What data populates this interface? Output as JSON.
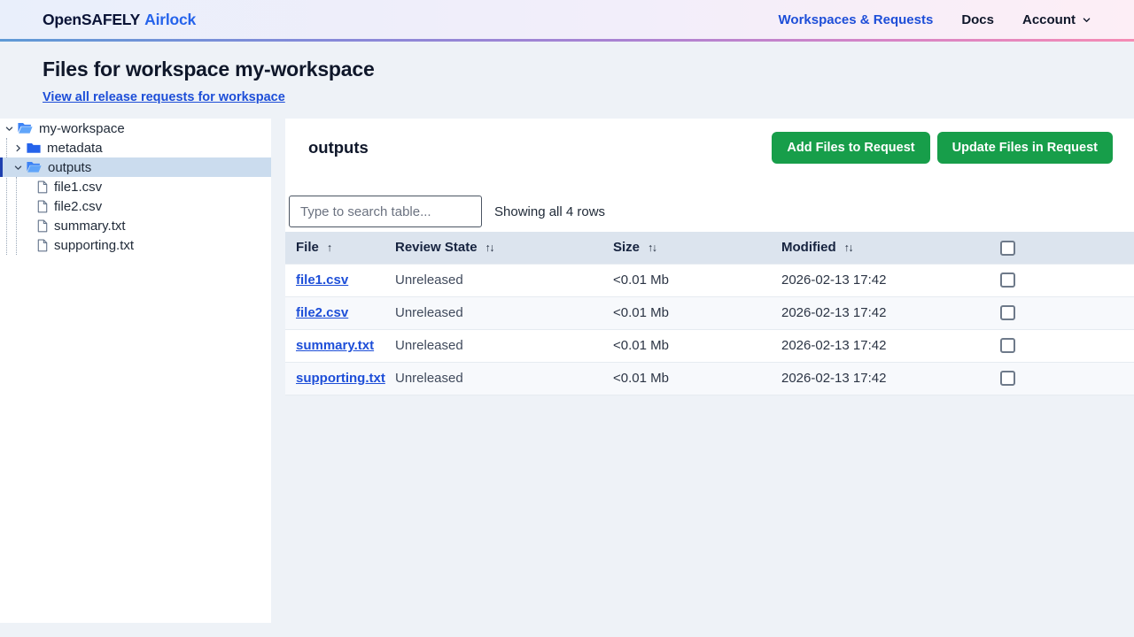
{
  "brand": {
    "name": "OpenSAFELY",
    "product": "Airlock"
  },
  "nav": {
    "workspaces_label": "Workspaces & Requests",
    "docs_label": "Docs",
    "account_label": "Account"
  },
  "page_header": {
    "title": "Files for workspace my-workspace",
    "link_label": "View all release requests for workspace"
  },
  "tree": {
    "items": [
      {
        "label": "my-workspace",
        "icon": "folder-open",
        "chevron": "down",
        "depth": 0,
        "selected": false
      },
      {
        "label": "metadata",
        "icon": "folder",
        "chevron": "right",
        "depth": 1,
        "selected": false
      },
      {
        "label": "outputs",
        "icon": "folder-open",
        "chevron": "down",
        "depth": 1,
        "selected": true
      },
      {
        "label": "file1.csv",
        "icon": "file",
        "chevron": null,
        "depth": 2,
        "selected": false
      },
      {
        "label": "file2.csv",
        "icon": "file",
        "chevron": null,
        "depth": 2,
        "selected": false
      },
      {
        "label": "summary.txt",
        "icon": "file",
        "chevron": null,
        "depth": 2,
        "selected": false
      },
      {
        "label": "supporting.txt",
        "icon": "file",
        "chevron": null,
        "depth": 2,
        "selected": false
      }
    ]
  },
  "main": {
    "title": "outputs",
    "add_button_label": "Add Files to Request",
    "update_button_label": "Update Files in Request",
    "search_placeholder": "Type to search table...",
    "row_count_text": "Showing all 4 rows",
    "table": {
      "columns": [
        {
          "label": "File",
          "sort": "asc"
        },
        {
          "label": "Review State",
          "sort": "both"
        },
        {
          "label": "Size",
          "sort": "both"
        },
        {
          "label": "Modified",
          "sort": "both"
        },
        {
          "label": "",
          "sort": "none"
        }
      ],
      "rows": [
        {
          "file": "file1.csv",
          "review_state": "Unreleased",
          "size": "<0.01 Mb",
          "modified": "2026-02-13 17:42",
          "checked": false
        },
        {
          "file": "file2.csv",
          "review_state": "Unreleased",
          "size": "<0.01 Mb",
          "modified": "2026-02-13 17:42",
          "checked": false
        },
        {
          "file": "summary.txt",
          "review_state": "Unreleased",
          "size": "<0.01 Mb",
          "modified": "2026-02-13 17:42",
          "checked": false
        },
        {
          "file": "supporting.txt",
          "review_state": "Unreleased",
          "size": "<0.01 Mb",
          "modified": "2026-02-13 17:42",
          "checked": false
        }
      ]
    }
  },
  "colors": {
    "accent_blue": "#1d4ed8",
    "brand_navy": "#0b1437",
    "button_green": "#179e4a",
    "selected_row_bg": "#cbdcee",
    "selected_row_bar": "#1e40af",
    "table_header_bg": "#dce4ee",
    "page_bg": "#eef2f7",
    "nav_gradient": [
      "#5e9ad6",
      "#8489d9",
      "#aa82d2",
      "#f58bb4"
    ]
  }
}
